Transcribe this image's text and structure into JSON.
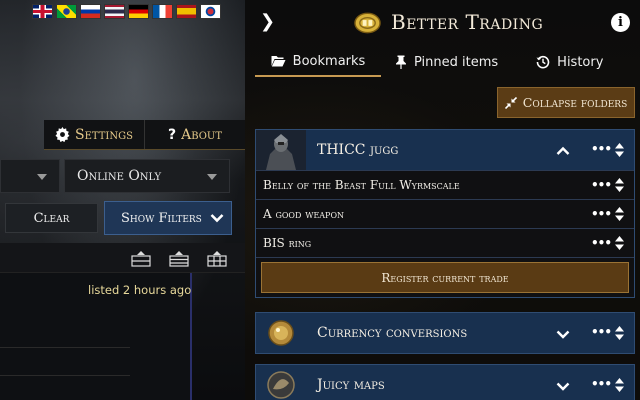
{
  "site": {
    "flags": [
      {
        "name": "flag-uk",
        "cls": "f-uk"
      },
      {
        "name": "flag-brazil",
        "cls": "f-br"
      },
      {
        "name": "flag-russia",
        "cls": "f-ru"
      },
      {
        "name": "flag-thailand",
        "cls": "f-th"
      },
      {
        "name": "flag-germany",
        "cls": "f-de"
      },
      {
        "name": "flag-france",
        "cls": "f-fr"
      },
      {
        "name": "flag-spain",
        "cls": "f-es"
      },
      {
        "name": "flag-korea",
        "cls": "f-kr"
      }
    ],
    "settings_label": "Settings",
    "about_label": "About",
    "select_online": "Online Only",
    "clear_label": "Clear",
    "show_filters_label": "Show Filters",
    "listed_text": "listed 2 hours ago"
  },
  "panel": {
    "title": "Better Trading",
    "tabs": [
      {
        "label": "Bookmarks",
        "icon": "folder-open-icon",
        "active": true
      },
      {
        "label": "Pinned items",
        "icon": "pin-icon",
        "active": false
      },
      {
        "label": "History",
        "icon": "history-icon",
        "active": false
      }
    ],
    "collapse_label": "Collapse folders",
    "folders": [
      {
        "title": "THICC jugg",
        "expanded": true,
        "trades": [
          {
            "title": "Belly of the Beast Full Wyrmscale"
          },
          {
            "title": "A good weapon"
          },
          {
            "title": "BIS ring"
          }
        ],
        "register_label": "Register current trade"
      },
      {
        "title": "Currency conversions",
        "expanded": false
      },
      {
        "title": "Juicy maps",
        "expanded": false
      }
    ]
  },
  "colors": {
    "accent_gold": "#c79a52",
    "folder_blue": "#18304f",
    "button_brown": "#5b3c15"
  }
}
